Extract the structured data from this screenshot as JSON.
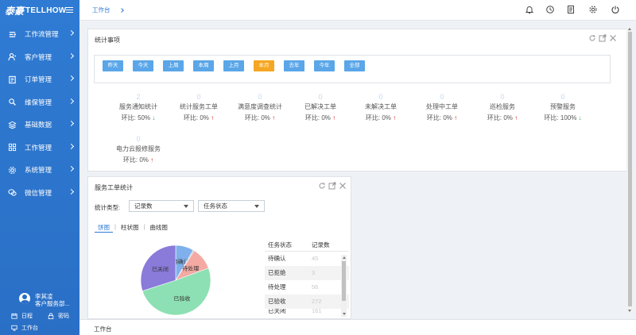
{
  "app": {
    "logo_cn": "泰豪",
    "logo_en": "TELLHOW"
  },
  "sidebar": {
    "items": [
      {
        "label": "工作流管理",
        "icon": "workflow-icon"
      },
      {
        "label": "客户管理",
        "icon": "customer-icon"
      },
      {
        "label": "订单管理",
        "icon": "order-icon"
      },
      {
        "label": "维保管理",
        "icon": "maintenance-icon"
      },
      {
        "label": "基础数据",
        "icon": "database-icon"
      },
      {
        "label": "工作管理",
        "icon": "grid-icon"
      },
      {
        "label": "系统管理",
        "icon": "gear-icon"
      },
      {
        "label": "微信管理",
        "icon": "wechat-icon"
      }
    ],
    "user": {
      "name": "李其凌",
      "dept": "客户服务部..."
    },
    "links": {
      "schedule": "日程",
      "password": "密码",
      "workbench": "工作台"
    }
  },
  "breadcrumb": {
    "current": "工作台"
  },
  "stats_panel": {
    "title": "统计事项",
    "filters": [
      "昨天",
      "今天",
      "上周",
      "本周",
      "上月",
      "本月",
      "去年",
      "今年",
      "全部"
    ],
    "active_filter": "本月",
    "items": [
      {
        "value": "2",
        "name": "服务通知统计",
        "ratio": "环比: 50%",
        "trend": "↓"
      },
      {
        "value": "0",
        "name": "统计服务工单",
        "ratio": "环比: 0%",
        "trend": "↑"
      },
      {
        "value": "0",
        "name": "满意度调查统计",
        "ratio": "环比: 0%",
        "trend": "↑"
      },
      {
        "value": "0",
        "name": "已解决工单",
        "ratio": "环比: 0%",
        "trend": "↑"
      },
      {
        "value": "0",
        "name": "未解决工单",
        "ratio": "环比: 0%",
        "trend": "↑"
      },
      {
        "value": "0",
        "name": "处理中工单",
        "ratio": "环比: 0%",
        "trend": "↑"
      },
      {
        "value": "0",
        "name": "巡检服务",
        "ratio": "环比: 0%",
        "trend": "↑"
      },
      {
        "value": "0",
        "name": "预警服务",
        "ratio": "环比: 100%",
        "trend": "↓"
      },
      {
        "value": "0",
        "name": "电力云报修服务",
        "ratio": "环比: 0%",
        "trend": "↑"
      }
    ]
  },
  "service_panel": {
    "title": "服务工单统计",
    "type_label": "统计类型:",
    "select1": "记录数",
    "select2": "任务状态",
    "tabs": [
      "饼图",
      "柱状图",
      "曲线图"
    ],
    "table": {
      "headers": [
        "任务状态",
        "记录数"
      ],
      "rows": [
        [
          "待确认",
          "45"
        ],
        [
          "已拒绝",
          "3"
        ],
        [
          "待处理",
          "56"
        ],
        [
          "已验收",
          "272"
        ],
        [
          "已关闭",
          "161"
        ]
      ]
    },
    "pie": {
      "slices": [
        {
          "label": "待确认",
          "value": 45,
          "color": "#7fb0ec"
        },
        {
          "label": "已拒绝",
          "value": 3,
          "color": "#aeb6bf"
        },
        {
          "label": "待处理",
          "value": 56,
          "color": "#f4a9a3"
        },
        {
          "label": "已验收",
          "value": 272,
          "color": "#8de0b3"
        },
        {
          "label": "已关闭",
          "value": 161,
          "color": "#8a7ad9"
        }
      ]
    }
  },
  "footer": {
    "tab": "工作台"
  },
  "colors": {
    "sidebar": "#2a6fc6",
    "accent": "#2f7bd3",
    "filter": "#5aa6e8",
    "active_filter": "#f5a623"
  }
}
